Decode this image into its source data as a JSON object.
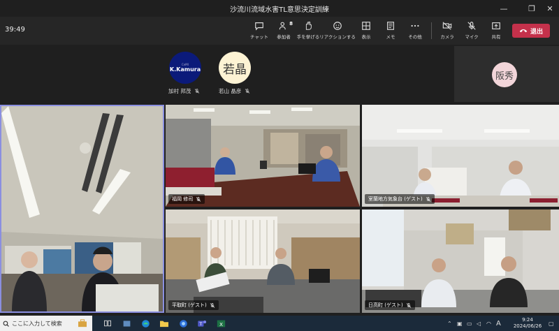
{
  "window": {
    "title": "沙流川流域水害TL意思決定訓練"
  },
  "meeting": {
    "timer": "39:49"
  },
  "toolbar": {
    "chat": "チャット",
    "participants": "参加者",
    "participants_count": "8",
    "raise_hand": "手を挙げる",
    "reactions": "リアクションする",
    "view": "表示",
    "notes": "メモ",
    "more": "その他",
    "camera": "カメラ",
    "mic": "マイク",
    "share": "共有",
    "leave": "退出"
  },
  "participants": {
    "kamura": {
      "avatar_top": "CeMI",
      "avatar_main": "K.Kamura",
      "name": "加村 邦茂"
    },
    "wakayama": {
      "initials": "若晶",
      "name": "若山 晶彦"
    },
    "hanshu": {
      "initials": "阪秀"
    }
  },
  "tiles": {
    "a": {
      "name": "福岡 修司"
    },
    "b": {
      "name": "室蘭地方気象台 (ゲスト)"
    },
    "c": {
      "name": "平取町 (ゲスト)"
    },
    "d": {
      "name": "日高町 (ゲスト)"
    }
  },
  "taskbar": {
    "search_placeholder": "ここに入力して検索",
    "ime": "A",
    "time": "9:24",
    "date": "2024/06/26"
  },
  "colors": {
    "leave": "#c4314b",
    "active_speaker_border": "#8a8fe0",
    "kamura_avatar": "#0b1a7a"
  }
}
